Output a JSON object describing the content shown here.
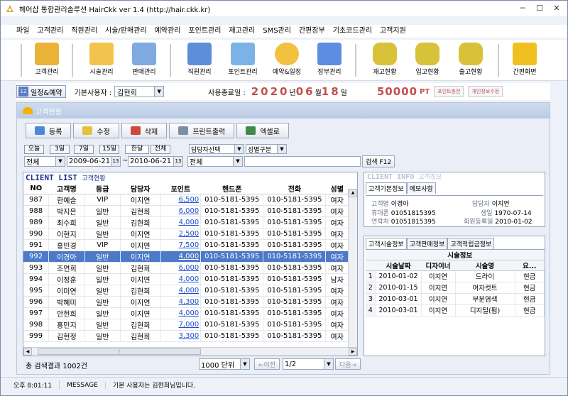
{
  "window": {
    "title": "헤어샵 통합관리솔루션 HairCkk ver 1.4 (http://hair.ckk.kr)"
  },
  "menu": [
    "파일",
    "고객관리",
    "직원관리",
    "시술/판매관리",
    "예약관리",
    "포인트관리",
    "재고관리",
    "SMS관리",
    "간편장부",
    "기초코드관리",
    "고객지원"
  ],
  "toolbar": [
    {
      "label": "고객관리",
      "icon": "customer-card-icon",
      "color": "#e9b33a"
    },
    {
      "label": "시술관리",
      "icon": "scissors-icon",
      "color": "#f2c34d"
    },
    {
      "label": "판매관리",
      "icon": "product-icon",
      "color": "#7fa9e0"
    },
    {
      "label": "직원관리",
      "icon": "staff-icon",
      "color": "#5c8fd8"
    },
    {
      "label": "포인트관리",
      "icon": "calculator-icon",
      "color": "#7bb3e6"
    },
    {
      "label": "예약&일정",
      "icon": "alarm-clock-icon",
      "color": "#f2c23e"
    },
    {
      "label": "장부관리",
      "icon": "ledger-icon",
      "color": "#5b8ee0"
    },
    {
      "label": "재고현황",
      "icon": "database-icon",
      "color": "#d8c23a"
    },
    {
      "label": "입고현황",
      "icon": "database-in-icon",
      "color": "#d8c23a"
    },
    {
      "label": "출고현황",
      "icon": "database-out-icon",
      "color": "#d8c23a"
    },
    {
      "label": "간편화면",
      "icon": "windows-icon",
      "color": "#f0c020"
    }
  ],
  "infobar": {
    "schedule_label": "일정&예약",
    "schedule_icon_text": "12",
    "user_label": "기본사용자 :",
    "user_value": "김현희",
    "expiry_label": "사용종료일 :",
    "year": "2020",
    "year_unit": "년",
    "month": "06",
    "month_unit": "월",
    "day": "18",
    "day_unit": "일",
    "points": "50000",
    "points_unit": "PT",
    "charge_btn": "포인트충전",
    "edit_btn": "개인정보수정"
  },
  "panel": {
    "title": "고객현황"
  },
  "actions": [
    {
      "label": "등록",
      "icon": "add-icon",
      "color": "#4e86d8"
    },
    {
      "label": "수정",
      "icon": "edit-icon",
      "color": "#e6c03a"
    },
    {
      "label": "삭제",
      "icon": "delete-icon",
      "color": "#d0473c"
    },
    {
      "label": "프린트출력",
      "icon": "print-icon",
      "color": "#7b8ea8"
    },
    {
      "label": "엑셀로",
      "icon": "excel-icon",
      "color": "#3d8a4a"
    }
  ],
  "filters": {
    "period_buttons": [
      "오늘",
      "3일",
      "7일",
      "15일",
      "한달",
      "전체"
    ],
    "all1": "전체",
    "date_from": "2009-06-21",
    "tilde": "~",
    "date_to": "2010-06-21",
    "staff_select": "담당자선택",
    "gender_select": "성별구분",
    "all2": "전체",
    "search_btn": "검색 F12"
  },
  "client_list": {
    "title": "CLIENT LIST",
    "subtitle": "고객현황",
    "columns": [
      "NO",
      "고객명",
      "등급",
      "담당자",
      "포인트",
      "핸드폰",
      "전화",
      "성별"
    ],
    "rows": [
      [
        "987",
        "한예슬",
        "VIP",
        "이지연",
        "6,500",
        "010-5181-5395",
        "010-5181-5395",
        "여자"
      ],
      [
        "988",
        "박지은",
        "일반",
        "김현희",
        "6,000",
        "010-5181-5395",
        "010-5181-5395",
        "여자"
      ],
      [
        "989",
        "최수희",
        "일반",
        "김현희",
        "4,000",
        "010-5181-5395",
        "010-5181-5395",
        "여자"
      ],
      [
        "990",
        "이현지",
        "일반",
        "이지연",
        "2,500",
        "010-5181-5395",
        "010-5181-5395",
        "여자"
      ],
      [
        "991",
        "홍민경",
        "VIP",
        "이지연",
        "7,500",
        "010-5181-5395",
        "010-5181-5395",
        "여자"
      ],
      [
        "992",
        "이경아",
        "일반",
        "이지연",
        "4,000",
        "010-5181-5395",
        "010-5181-5395",
        "여자"
      ],
      [
        "993",
        "조연희",
        "일반",
        "김현희",
        "6,000",
        "010-5181-5395",
        "010-5181-5395",
        "여자"
      ],
      [
        "994",
        "이정훈",
        "일반",
        "이지연",
        "4,000",
        "010-5181-5395",
        "010-5181-5395",
        "남자"
      ],
      [
        "995",
        "이미연",
        "일반",
        "김현희",
        "4,000",
        "010-5181-5395",
        "010-5181-5395",
        "여자"
      ],
      [
        "996",
        "박혜미",
        "일반",
        "이지연",
        "4,300",
        "010-5181-5395",
        "010-5181-5395",
        "여자"
      ],
      [
        "997",
        "안현희",
        "일반",
        "이지연",
        "4,000",
        "010-5181-5395",
        "010-5181-5395",
        "여자"
      ],
      [
        "998",
        "홍민지",
        "일반",
        "김현희",
        "7,000",
        "010-5181-5395",
        "010-5181-5395",
        "여자"
      ],
      [
        "999",
        "김현정",
        "일반",
        "김현희",
        "3,300",
        "010-5181-5395",
        "010-5181-5395",
        "여자"
      ]
    ],
    "selected_index": 5
  },
  "pager": {
    "total_label": "총 검색결과 1002건",
    "unit_select": "1000 단위",
    "prev": "←이전",
    "page": "1/2",
    "next": "다음→"
  },
  "client_info": {
    "title": "CLIENT INFO",
    "subtitle": "고객정보",
    "tabs": [
      "고객기본정보",
      "메모사항"
    ],
    "name_label": "고객명",
    "name": "이경아",
    "staff_label": "담당자",
    "staff": "이지연",
    "phone_label": "휴대폰",
    "phone": "01051815395",
    "birth_label": "생일",
    "birth": "1970-07-14",
    "contact_label": "연락처",
    "contact": "01051815395",
    "joined_label": "회원등록일",
    "joined": "2010-01-02"
  },
  "history": {
    "tabs": [
      "고객시술정보",
      "고객판매정보",
      "고객적립금정보"
    ],
    "group_header": "시술정보",
    "columns": [
      "",
      "시술날짜",
      "디자이너",
      "시술명",
      "요..."
    ],
    "rows": [
      [
        "1",
        "2010-01-02",
        "이지연",
        "드라이",
        "현금"
      ],
      [
        "2",
        "2010-01-15",
        "이지연",
        "여자컷트",
        "현금"
      ],
      [
        "3",
        "2010-03-01",
        "이지연",
        "부분염색",
        "현금"
      ],
      [
        "4",
        "2010-03-01",
        "이지연",
        "디지털(펌)",
        "현금"
      ]
    ]
  },
  "status": {
    "time": "오후 8:01:11",
    "message_label": "MESSAGE",
    "message": "기본 사용자는 김현희님입니다."
  }
}
